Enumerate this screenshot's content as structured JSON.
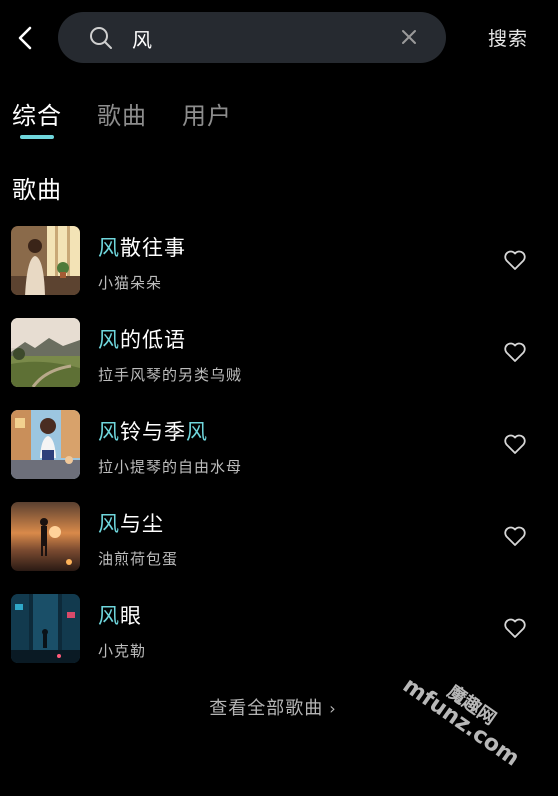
{
  "header": {
    "search_value": "风",
    "search_button_label": "搜索"
  },
  "tabs": [
    {
      "label": "综合",
      "active": true
    },
    {
      "label": "歌曲",
      "active": false
    },
    {
      "label": "用户",
      "active": false
    }
  ],
  "section": {
    "title": "歌曲"
  },
  "songs": [
    {
      "title_parts": [
        {
          "text": "风",
          "highlight": true
        },
        {
          "text": "散往事",
          "highlight": false
        }
      ],
      "artist": "小猫朵朵",
      "cover": "girl-by-window"
    },
    {
      "title_parts": [
        {
          "text": "风",
          "highlight": true
        },
        {
          "text": "的低语",
          "highlight": false
        }
      ],
      "artist": "拉手风琴的另类乌贼",
      "cover": "meadow-landscape"
    },
    {
      "title_parts": [
        {
          "text": "风",
          "highlight": true
        },
        {
          "text": "铃与季",
          "highlight": false
        },
        {
          "text": "风",
          "highlight": true
        }
      ],
      "artist": "拉小提琴的自由水母",
      "cover": "anime-girl-street"
    },
    {
      "title_parts": [
        {
          "text": "风",
          "highlight": true
        },
        {
          "text": "与尘",
          "highlight": false
        }
      ],
      "artist": "油煎荷包蛋",
      "cover": "sunset-figure"
    },
    {
      "title_parts": [
        {
          "text": "风",
          "highlight": true
        },
        {
          "text": "眼",
          "highlight": false
        }
      ],
      "artist": "小克勒",
      "cover": "neon-alley"
    }
  ],
  "view_all": {
    "label": "查看全部歌曲",
    "chevron": "›"
  },
  "watermark": {
    "line1": "魔趣网",
    "line2": "mfunz.com"
  },
  "colors": {
    "highlight": "#6fd6dc",
    "background": "#000000",
    "search_bg": "#262a30"
  }
}
